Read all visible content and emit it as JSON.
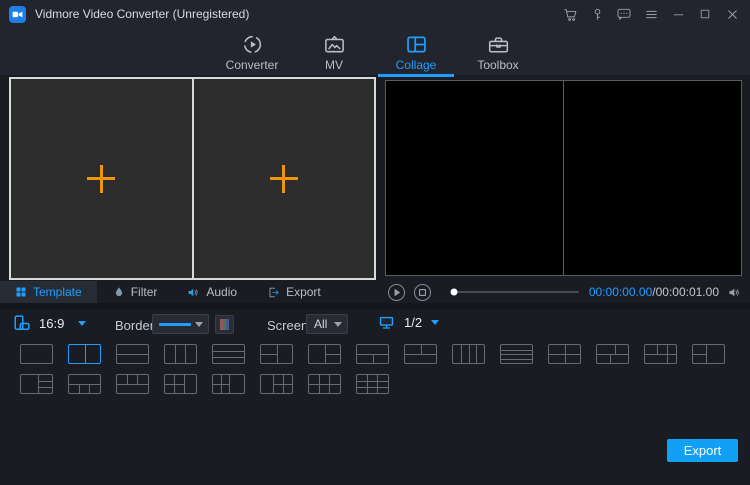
{
  "titlebar": {
    "title": "Vidmore Video Converter (Unregistered)",
    "icons": [
      "app-logo-icon",
      "cart-icon",
      "key-icon",
      "feedback-icon",
      "menu-icon",
      "minimize-icon",
      "maximize-icon",
      "close-icon"
    ]
  },
  "nav": {
    "tabs": [
      {
        "label": "Converter",
        "icon": "converter-icon",
        "active": false
      },
      {
        "label": "MV",
        "icon": "mv-icon",
        "active": false
      },
      {
        "label": "Collage",
        "icon": "collage-icon",
        "active": true
      },
      {
        "label": "Toolbox",
        "icon": "toolbox-icon",
        "active": false
      }
    ]
  },
  "editor": {
    "cells": 2,
    "add_icon": "plus-icon",
    "plus_color": "#f09410"
  },
  "panel_tabs": [
    {
      "label": "Template",
      "icon": "template-icon",
      "active": true
    },
    {
      "label": "Filter",
      "icon": "filter-icon",
      "active": false
    },
    {
      "label": "Audio",
      "icon": "audio-icon",
      "active": false
    },
    {
      "label": "Export",
      "icon": "export-icon",
      "active": false
    }
  ],
  "player": {
    "icons": [
      "play-icon",
      "stop-icon",
      "volume-icon"
    ],
    "progress_percent": 0,
    "current_time": "00:00:00.00",
    "time_separator": "/",
    "total_time": "00:00:01.00"
  },
  "toolbar": {
    "aspect_ratio": "16:9",
    "border_label": "Border:",
    "screen_label": "Screen:",
    "screen_value": "All",
    "page_indicator": "1/2"
  },
  "templates": {
    "accent": "#1e9fff",
    "row1": [
      {
        "lines": []
      },
      {
        "selected": true,
        "lines": [
          {
            "o": "v",
            "p": 50
          }
        ]
      },
      {
        "lines": [
          {
            "o": "h",
            "p": 50
          }
        ]
      },
      {
        "lines": [
          {
            "o": "v",
            "p": 33
          },
          {
            "o": "v",
            "p": 66
          }
        ]
      },
      {
        "lines": [
          {
            "o": "h",
            "p": 33
          },
          {
            "o": "h",
            "p": 66
          }
        ]
      },
      {
        "lines": [
          {
            "o": "v",
            "p": 50
          },
          {
            "o": "h",
            "p": 50,
            "a": 0,
            "b": 50
          }
        ]
      },
      {
        "lines": [
          {
            "o": "v",
            "p": 50
          },
          {
            "o": "h",
            "p": 50,
            "a": 50,
            "b": 100
          }
        ]
      },
      {
        "lines": [
          {
            "o": "h",
            "p": 50
          },
          {
            "o": "v",
            "p": 50,
            "a": 50,
            "b": 100
          }
        ]
      },
      {
        "lines": [
          {
            "o": "h",
            "p": 50
          },
          {
            "o": "v",
            "p": 50,
            "a": 0,
            "b": 50
          }
        ]
      },
      {
        "lines": [
          {
            "o": "v",
            "p": 25
          },
          {
            "o": "v",
            "p": 50
          },
          {
            "o": "v",
            "p": 75
          }
        ]
      },
      {
        "lines": [
          {
            "o": "h",
            "p": 25
          },
          {
            "o": "h",
            "p": 50
          },
          {
            "o": "h",
            "p": 75
          }
        ]
      },
      {
        "lines": [
          {
            "o": "v",
            "p": 50
          },
          {
            "o": "h",
            "p": 50
          }
        ]
      },
      {
        "lines": [
          {
            "o": "h",
            "p": 50
          },
          {
            "o": "v",
            "p": 58,
            "a": 0,
            "b": 50
          },
          {
            "o": "v",
            "p": 42,
            "a": 50,
            "b": 100
          }
        ]
      },
      {
        "lines": [
          {
            "o": "h",
            "p": 50
          },
          {
            "o": "v",
            "p": 38,
            "a": 0,
            "b": 50
          },
          {
            "o": "v",
            "p": 70,
            "a": 0,
            "b": 100
          }
        ]
      },
      {
        "lines": [
          {
            "o": "v",
            "p": 42
          },
          {
            "o": "h",
            "p": 50,
            "a": 0,
            "b": 42
          }
        ]
      }
    ],
    "row2": [
      {
        "lines": [
          {
            "o": "v",
            "p": 55
          },
          {
            "o": "h",
            "p": 33,
            "a": 55,
            "b": 100
          },
          {
            "o": "h",
            "p": 66,
            "a": 55,
            "b": 100
          }
        ]
      },
      {
        "lines": [
          {
            "o": "h",
            "p": 50
          },
          {
            "o": "v",
            "p": 33,
            "a": 50,
            "b": 100
          },
          {
            "o": "v",
            "p": 66,
            "a": 50,
            "b": 100
          }
        ]
      },
      {
        "lines": [
          {
            "o": "h",
            "p": 50
          },
          {
            "o": "v",
            "p": 33,
            "a": 0,
            "b": 50
          },
          {
            "o": "v",
            "p": 66,
            "a": 0,
            "b": 50
          }
        ]
      },
      {
        "lines": [
          {
            "o": "v",
            "p": 30
          },
          {
            "o": "v",
            "p": 60
          },
          {
            "o": "h",
            "p": 50,
            "a": 0,
            "b": 60
          }
        ]
      },
      {
        "lines": [
          {
            "o": "v",
            "p": 25
          },
          {
            "o": "v",
            "p": 50
          },
          {
            "o": "h",
            "p": 50,
            "a": 0,
            "b": 50
          }
        ]
      },
      {
        "lines": [
          {
            "o": "v",
            "p": 40
          },
          {
            "o": "v",
            "p": 70
          },
          {
            "o": "h",
            "p": 50,
            "a": 40,
            "b": 100
          }
        ]
      },
      {
        "lines": [
          {
            "o": "v",
            "p": 33
          },
          {
            "o": "v",
            "p": 66
          },
          {
            "o": "h",
            "p": 50
          }
        ]
      },
      {
        "lines": [
          {
            "o": "v",
            "p": 33
          },
          {
            "o": "v",
            "p": 66
          },
          {
            "o": "h",
            "p": 33
          },
          {
            "o": "h",
            "p": 66
          }
        ]
      }
    ]
  },
  "footer": {
    "export_label": "Export"
  },
  "colors": {
    "accent": "#1e9fff",
    "titlebar_bg": "#23252e",
    "window_bg": "#1a1c24",
    "cell_bg": "#2d2d2d",
    "export_button": "#12a0f4"
  }
}
